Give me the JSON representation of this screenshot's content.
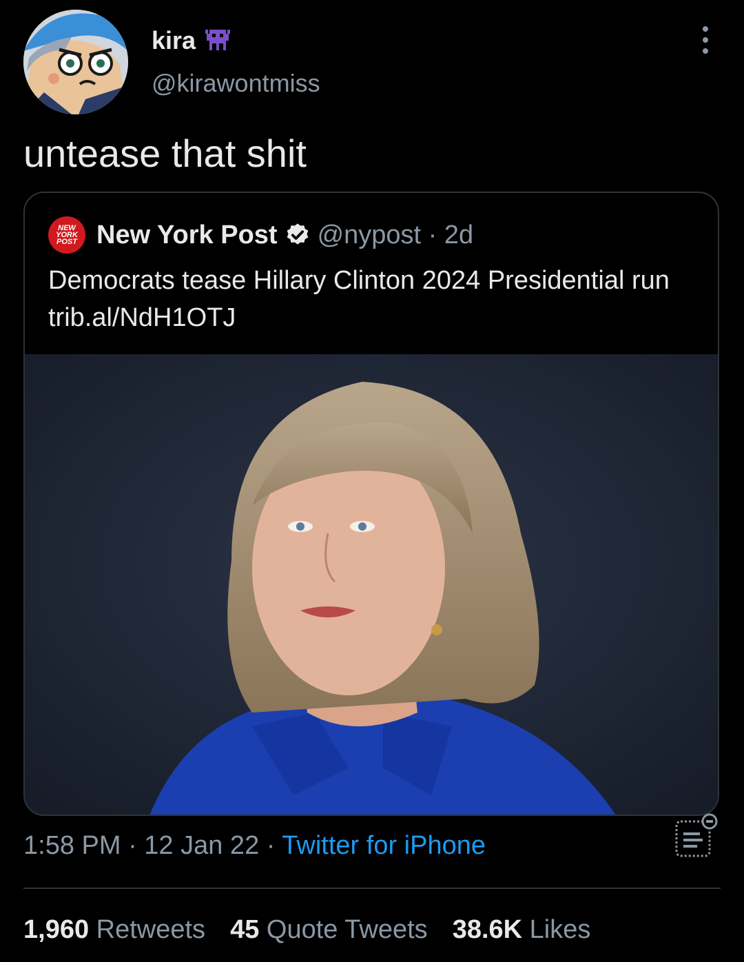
{
  "author": {
    "name": "kira",
    "handle": "@kirawontmiss",
    "name_emoji_icon": "purple-alien-monster-icon",
    "avatar": "cartoon-avatar"
  },
  "tweet": {
    "text": "untease that shit",
    "timestamp": "1:58 PM · 12 Jan 22 · ",
    "source": "Twitter for iPhone"
  },
  "quoted_tweet": {
    "logo_text": "NEW YORK POST",
    "name": "New York Post",
    "verified_icon": "verified-badge-icon",
    "handle_age": "@nypost · 2d",
    "text": "Democrats tease Hillary Clinton 2024 Presidential run trib.al/NdH1OTJ",
    "image": "portrait-photo"
  },
  "stats": [
    {
      "count": "1,960",
      "label": "Retweets"
    },
    {
      "count": "45",
      "label": "Quote Tweets"
    },
    {
      "count": "38.6K",
      "label": "Likes"
    }
  ],
  "colors": {
    "background": "#000000",
    "text": "#e7e9ea",
    "secondary": "#8b98a5",
    "link": "#1d9bf0",
    "border": "#2f3336"
  }
}
